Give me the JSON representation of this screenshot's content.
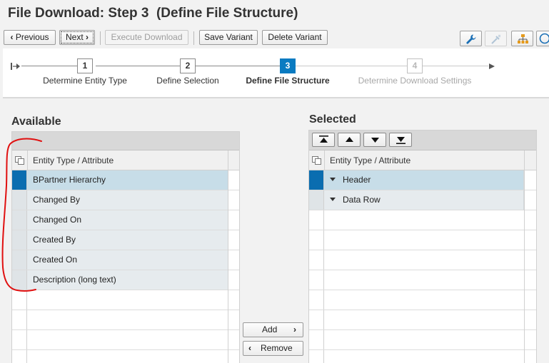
{
  "window": {
    "title": "File Download: Step 3  (Define File Structure)"
  },
  "toolbar": {
    "previous_label": "Previous",
    "next_label": "Next",
    "execute_label": "Execute Download",
    "save_variant_label": "Save Variant",
    "delete_variant_label": "Delete Variant",
    "icons": [
      "wrench-icon",
      "edit-settings-icon",
      "hierarchy-icon",
      "help-icon"
    ]
  },
  "roadmap": {
    "steps": [
      {
        "number": "1",
        "label": "Determine Entity Type",
        "state": "done"
      },
      {
        "number": "2",
        "label": "Define Selection",
        "state": "done"
      },
      {
        "number": "3",
        "label": "Define File Structure",
        "state": "active"
      },
      {
        "number": "4",
        "label": "Determine Download Settings",
        "state": "disabled"
      }
    ]
  },
  "available": {
    "title": "Available",
    "column_header": "Entity Type / Attribute",
    "rows": [
      "BPartner Hierarchy",
      "Changed By",
      "Changed On",
      "Created By",
      "Created On",
      "Description (long text)"
    ]
  },
  "selected": {
    "title": "Selected",
    "column_header": "Entity Type / Attribute",
    "rows": [
      "Header",
      "Data Row"
    ],
    "move_buttons": [
      "move-to-top-icon",
      "move-up-icon",
      "move-down-icon",
      "move-to-bottom-icon"
    ]
  },
  "actions": {
    "add_label": "Add",
    "remove_label": "Remove"
  },
  "colors": {
    "accent": "#0a7bc1",
    "selected_row": "#c7dde8",
    "annotation": "#e01010"
  }
}
